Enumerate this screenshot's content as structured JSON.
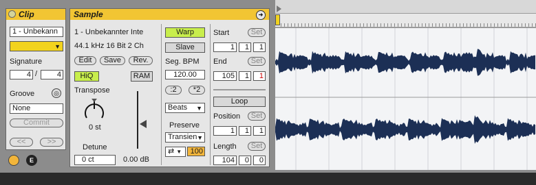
{
  "clip": {
    "title": "Clip",
    "name": "1 - Unbekann",
    "signature_label": "Signature",
    "signature_num": "4",
    "signature_sep": "/",
    "signature_den": "4",
    "groove_label": "Groove",
    "groove_value": "None",
    "commit_label": "Commit",
    "prev_label": "<<",
    "next_label": ">>"
  },
  "sample": {
    "title": "Sample",
    "name": "1 - Unbekannter Inte",
    "info": "44.1 kHz 16 Bit 2 Ch",
    "edit_label": "Edit",
    "save_label": "Save",
    "rev_label": "Rev.",
    "hiq_label": "HiQ",
    "ram_label": "RAM",
    "transpose_label": "Transpose",
    "transpose_value": "0 st",
    "detune_label": "Detune",
    "detune_value": "0 ct",
    "gain_value": "0.00 dB",
    "warp_label": "Warp",
    "slave_label": "Slave",
    "seg_bpm_label": "Seg. BPM",
    "seg_bpm_value": "120.00",
    "half_label": ":2",
    "double_label": "*2",
    "warp_mode": "Beats",
    "preserve_label": "Preserve",
    "preserve_value": "Transien",
    "loop_mode_symbol": "⇄",
    "loop_amount": "100",
    "start_label": "Start",
    "set_label": "Set",
    "start_values": [
      "1",
      "1",
      "1"
    ],
    "end_label": "End",
    "end_values": [
      "105",
      "1",
      "1"
    ],
    "loop_label": "Loop",
    "position_label": "Position",
    "position_values": [
      "1",
      "1",
      "1"
    ],
    "length_label": "Length",
    "length_values": [
      "104",
      "0",
      "0"
    ]
  },
  "colors": {
    "header": "#f2c533",
    "warp_active": "#c8ee4c",
    "waveform": "#1c2f55",
    "loop_amount_bg": "#f3b53a",
    "end_highlight": "#cc0000"
  }
}
